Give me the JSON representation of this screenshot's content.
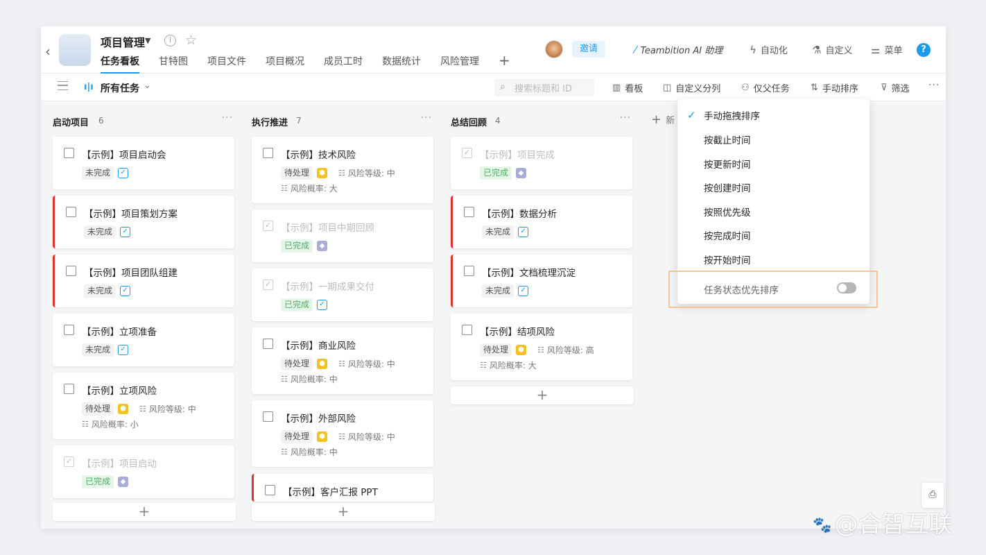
{
  "header": {
    "project_title": "项目管理",
    "tabs": [
      "任务看板",
      "甘特图",
      "项目文件",
      "项目概况",
      "成员工时",
      "数据统计",
      "风险管理"
    ],
    "invite_label": "邀请",
    "ai_label": "Teambition AI 助理",
    "automation_label": "自动化",
    "custom_label": "自定义",
    "menu_label": "菜单"
  },
  "toolbar": {
    "view_label": "所有任务",
    "search_placeholder": "搜索标题和 ID",
    "board_label": "看板",
    "custom_group_label": "自定义分列",
    "parent_only_label": "仅父任务",
    "sort_label": "手动排序",
    "filter_label": "筛选"
  },
  "columns": [
    {
      "title": "启动项目",
      "count": "6",
      "cards": [
        {
          "title": "【示例】项目启动会",
          "status": "未完成",
          "type": "task",
          "flag": false,
          "done": false
        },
        {
          "title": "【示例】项目策划方案",
          "status": "未完成",
          "type": "task",
          "flag": true,
          "done": false
        },
        {
          "title": "【示例】项目团队组建",
          "status": "未完成",
          "type": "task",
          "flag": true,
          "done": false
        },
        {
          "title": "【示例】立项准备",
          "status": "未完成",
          "type": "task",
          "flag": false,
          "done": false
        },
        {
          "title": "【示例】立项风险",
          "status": "待处理",
          "type": "risk",
          "flag": false,
          "done": false,
          "level": "风险等级: 中",
          "probability": "风险概率: 小"
        },
        {
          "title": "【示例】项目启动",
          "status": "已完成",
          "type": "milestone",
          "flag": false,
          "done": true
        }
      ]
    },
    {
      "title": "执行推进",
      "count": "7",
      "cards": [
        {
          "title": "【示例】技术风险",
          "status": "待处理",
          "type": "risk",
          "flag": false,
          "done": false,
          "level": "风险等级: 中",
          "probability": "风险概率: 大"
        },
        {
          "title": "【示例】项目中期回顾",
          "status": "已完成",
          "type": "milestone",
          "flag": false,
          "done": true
        },
        {
          "title": "【示例】一期成果交付",
          "status": "已完成",
          "type": "task",
          "flag": false,
          "done": true
        },
        {
          "title": "【示例】商业风险",
          "status": "待处理",
          "type": "risk",
          "flag": false,
          "done": false,
          "level": "风险等级: 中",
          "probability": "风险概率: 中"
        },
        {
          "title": "【示例】外部风险",
          "status": "待处理",
          "type": "risk",
          "flag": false,
          "done": false,
          "level": "风险等级: 中",
          "probability": "风险概率: 中"
        },
        {
          "title": "【示例】客户汇报 PPT",
          "status": "",
          "type": "task",
          "flag": true,
          "done": false
        }
      ]
    },
    {
      "title": "总结回顾",
      "count": "4",
      "cards": [
        {
          "title": "【示例】项目完成",
          "status": "已完成",
          "type": "milestone",
          "flag": false,
          "done": true
        },
        {
          "title": "【示例】数据分析",
          "status": "未完成",
          "type": "task",
          "flag": true,
          "done": false
        },
        {
          "title": "【示例】文档梳理沉淀",
          "status": "未完成",
          "type": "task",
          "flag": true,
          "done": false
        },
        {
          "title": "【示例】结项风险",
          "status": "待处理",
          "type": "risk",
          "flag": false,
          "done": false,
          "level": "风险等级: 高",
          "probability": "风险概率: 大"
        }
      ]
    }
  ],
  "new_column_label": "新",
  "sort_menu": {
    "items": [
      "手动拖拽排序",
      "按截止时间",
      "按更新时间",
      "按创建时间",
      "按照优先级",
      "按完成时间",
      "按开始时间"
    ],
    "selected": "手动拖拽排序",
    "toggle_label": "任务状态优先排序",
    "toggle_on": false
  },
  "watermark": "@合智互联",
  "colors": {
    "accent": "#1b9aee",
    "flag": "#e03030",
    "risk": "#f4c21e",
    "milestone": "#a8acd6",
    "done": "#4caf60"
  }
}
